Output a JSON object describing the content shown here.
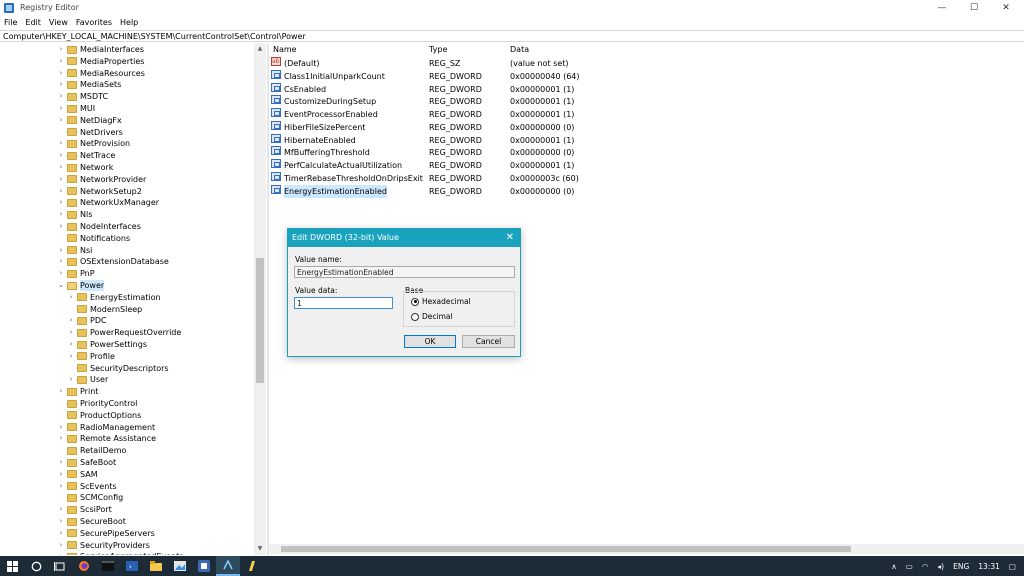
{
  "window": {
    "title": "Registry Editor",
    "minimize_glyph": "—",
    "maximize_glyph": "☐",
    "close_glyph": "✕"
  },
  "menu": [
    "File",
    "Edit",
    "View",
    "Favorites",
    "Help"
  ],
  "address": "Computer\\HKEY_LOCAL_MACHINE\\SYSTEM\\CurrentControlSet\\Control\\Power",
  "tree": [
    {
      "label": "MediaInterfaces",
      "depth": 0,
      "expander": "collapsed"
    },
    {
      "label": "MediaProperties",
      "depth": 0,
      "expander": "collapsed"
    },
    {
      "label": "MediaResources",
      "depth": 0,
      "expander": "collapsed"
    },
    {
      "label": "MediaSets",
      "depth": 0,
      "expander": "collapsed"
    },
    {
      "label": "MSDTC",
      "depth": 0,
      "expander": "collapsed"
    },
    {
      "label": "MUI",
      "depth": 0,
      "expander": "collapsed"
    },
    {
      "label": "NetDiagFx",
      "depth": 0,
      "expander": "collapsed"
    },
    {
      "label": "NetDrivers",
      "depth": 0,
      "expander": "none"
    },
    {
      "label": "NetProvision",
      "depth": 0,
      "expander": "collapsed"
    },
    {
      "label": "NetTrace",
      "depth": 0,
      "expander": "collapsed"
    },
    {
      "label": "Network",
      "depth": 0,
      "expander": "collapsed"
    },
    {
      "label": "NetworkProvider",
      "depth": 0,
      "expander": "collapsed"
    },
    {
      "label": "NetworkSetup2",
      "depth": 0,
      "expander": "collapsed"
    },
    {
      "label": "NetworkUxManager",
      "depth": 0,
      "expander": "collapsed"
    },
    {
      "label": "Nls",
      "depth": 0,
      "expander": "collapsed"
    },
    {
      "label": "NodeInterfaces",
      "depth": 0,
      "expander": "collapsed"
    },
    {
      "label": "Notifications",
      "depth": 0,
      "expander": "none"
    },
    {
      "label": "Nsi",
      "depth": 0,
      "expander": "collapsed"
    },
    {
      "label": "OSExtensionDatabase",
      "depth": 0,
      "expander": "collapsed"
    },
    {
      "label": "PnP",
      "depth": 0,
      "expander": "collapsed"
    },
    {
      "label": "Power",
      "depth": 0,
      "expander": "expanded",
      "selected": true
    },
    {
      "label": "EnergyEstimation",
      "depth": 1,
      "expander": "collapsed"
    },
    {
      "label": "ModernSleep",
      "depth": 1,
      "expander": "none"
    },
    {
      "label": "PDC",
      "depth": 1,
      "expander": "collapsed"
    },
    {
      "label": "PowerRequestOverride",
      "depth": 1,
      "expander": "collapsed"
    },
    {
      "label": "PowerSettings",
      "depth": 1,
      "expander": "collapsed"
    },
    {
      "label": "Profile",
      "depth": 1,
      "expander": "collapsed"
    },
    {
      "label": "SecurityDescriptors",
      "depth": 1,
      "expander": "none"
    },
    {
      "label": "User",
      "depth": 1,
      "expander": "collapsed"
    },
    {
      "label": "Print",
      "depth": 0,
      "expander": "collapsed"
    },
    {
      "label": "PriorityControl",
      "depth": 0,
      "expander": "none"
    },
    {
      "label": "ProductOptions",
      "depth": 0,
      "expander": "none"
    },
    {
      "label": "RadioManagement",
      "depth": 0,
      "expander": "collapsed"
    },
    {
      "label": "Remote Assistance",
      "depth": 0,
      "expander": "collapsed"
    },
    {
      "label": "RetailDemo",
      "depth": 0,
      "expander": "none"
    },
    {
      "label": "SafeBoot",
      "depth": 0,
      "expander": "collapsed"
    },
    {
      "label": "SAM",
      "depth": 0,
      "expander": "collapsed"
    },
    {
      "label": "ScEvents",
      "depth": 0,
      "expander": "collapsed"
    },
    {
      "label": "SCMConfig",
      "depth": 0,
      "expander": "none"
    },
    {
      "label": "ScsiPort",
      "depth": 0,
      "expander": "collapsed"
    },
    {
      "label": "SecureBoot",
      "depth": 0,
      "expander": "collapsed"
    },
    {
      "label": "SecurePipeServers",
      "depth": 0,
      "expander": "collapsed"
    },
    {
      "label": "SecurityProviders",
      "depth": 0,
      "expander": "collapsed"
    },
    {
      "label": "ServiceAggregatedEvents",
      "depth": 0,
      "expander": "collapsed"
    }
  ],
  "list": {
    "columns": [
      "Name",
      "Type",
      "Data"
    ],
    "rows": [
      {
        "name": "(Default)",
        "type": "REG_SZ",
        "data": "(value not set)",
        "icon": "string-value-icon"
      },
      {
        "name": "Class1InitialUnparkCount",
        "type": "REG_DWORD",
        "data": "0x00000040 (64)",
        "icon": "dword-value-icon"
      },
      {
        "name": "CsEnabled",
        "type": "REG_DWORD",
        "data": "0x00000001 (1)",
        "icon": "dword-value-icon"
      },
      {
        "name": "CustomizeDuringSetup",
        "type": "REG_DWORD",
        "data": "0x00000001 (1)",
        "icon": "dword-value-icon"
      },
      {
        "name": "EventProcessorEnabled",
        "type": "REG_DWORD",
        "data": "0x00000001 (1)",
        "icon": "dword-value-icon"
      },
      {
        "name": "HiberFileSizePercent",
        "type": "REG_DWORD",
        "data": "0x00000000 (0)",
        "icon": "dword-value-icon"
      },
      {
        "name": "HibernateEnabled",
        "type": "REG_DWORD",
        "data": "0x00000001 (1)",
        "icon": "dword-value-icon"
      },
      {
        "name": "MfBufferingThreshold",
        "type": "REG_DWORD",
        "data": "0x00000000 (0)",
        "icon": "dword-value-icon"
      },
      {
        "name": "PerfCalculateActualUtilization",
        "type": "REG_DWORD",
        "data": "0x00000001 (1)",
        "icon": "dword-value-icon"
      },
      {
        "name": "TimerRebaseThresholdOnDripsExit",
        "type": "REG_DWORD",
        "data": "0x0000003c (60)",
        "icon": "dword-value-icon"
      },
      {
        "name": "EnergyEstimationEnabled",
        "type": "REG_DWORD",
        "data": "0x00000000 (0)",
        "icon": "dword-value-icon",
        "selected": true
      }
    ]
  },
  "dialog": {
    "title": "Edit DWORD (32-bit) Value",
    "value_name_label": "Value name:",
    "value_name": "EnergyEstimationEnabled",
    "value_data_label": "Value data:",
    "value_data": "1",
    "base_label": "Base",
    "hex_label": "Hexadecimal",
    "dec_label": "Decimal",
    "base_selected": "Hexadecimal",
    "ok_label": "OK",
    "cancel_label": "Cancel"
  },
  "taskbar": {
    "language": "ENG",
    "time": "13:31",
    "accent": "#1aa3bf"
  }
}
